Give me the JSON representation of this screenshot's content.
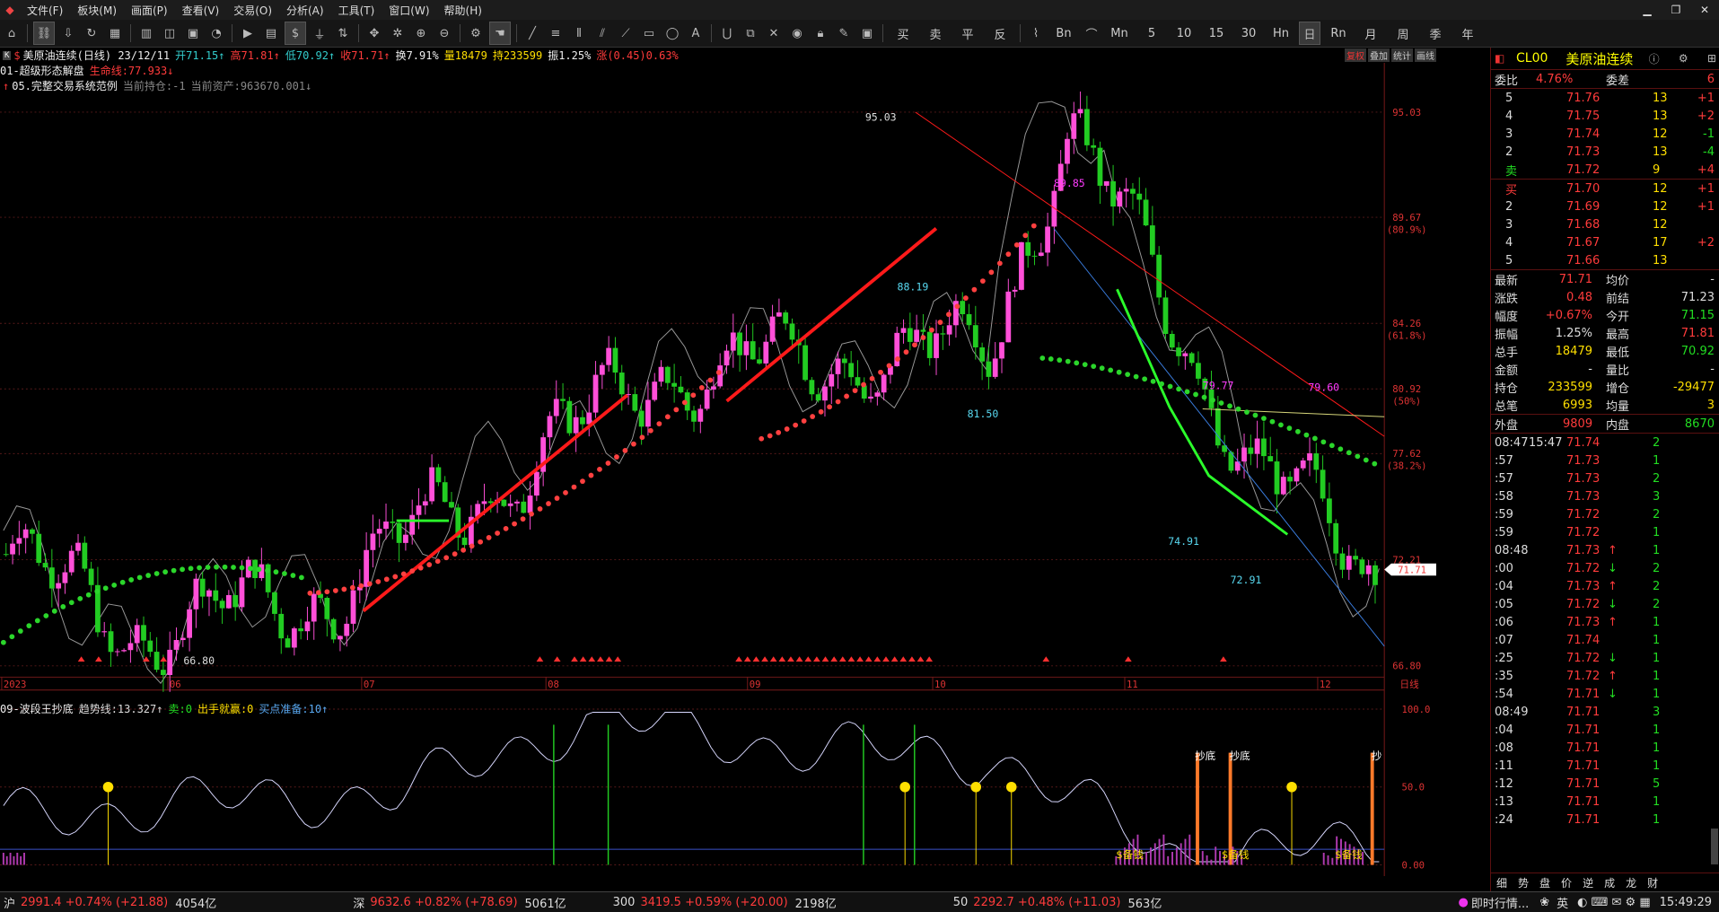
{
  "menu": {
    "items": [
      "文件(F)",
      "板块(M)",
      "画面(P)",
      "查看(V)",
      "交易(O)",
      "分析(A)",
      "工具(T)",
      "窗口(W)",
      "帮助(H)"
    ]
  },
  "toolbar": {
    "period_buttons": [
      "买",
      "卖",
      "平",
      "反"
    ],
    "interval_buttons": [
      "Bn",
      "Mn",
      "5",
      "10",
      "15",
      "30",
      "Hn",
      "Rn",
      "月",
      "季",
      "年"
    ],
    "dollar": "$"
  },
  "chart_header": {
    "title": "美原油连续(日线) 23/12/11",
    "open": "开71.15↑",
    "high": "高71.81↑",
    "low": "低70.92↑",
    "close": "收71.71↑",
    "turnover": "换7.91%",
    "volume": "量18479",
    "oi": "持233599",
    "amplitude": "振1.25%",
    "change": "涨(0.45)0.63%",
    "line2_name": "01-超级形态解盘",
    "line2_value": "生命线:77.933↓",
    "line3_name": "05.完整交易系统范例",
    "line3_pos": "当前持仓:-1",
    "line3_assets": "当前资产:963670.001↓",
    "right_buttons": [
      "复权",
      "叠加",
      "统计",
      "画线"
    ]
  },
  "price_axis": {
    "ticks": [
      "95.03",
      "89.67",
      "(80.9%)",
      "84.26",
      "(61.8%)",
      "80.92",
      "(50%)",
      "77.62",
      "(38.2%)",
      "72.21",
      "66.80"
    ],
    "current_price": "71.71"
  },
  "date_axis": {
    "labels": [
      "2023",
      "06",
      "07",
      "08",
      "09",
      "10",
      "11",
      "12"
    ],
    "end_label": "日线"
  },
  "annotations": {
    "high": "95.03",
    "p8985": "89.85",
    "p8819": "88.19",
    "p8150": "81.50",
    "p7977": "79.77",
    "p7960": "79.60",
    "p7491": "74.91",
    "p7291": "72.91",
    "low": "66.80"
  },
  "chart_data": [
    {
      "type": "line",
      "title": "美原油连续(日线)",
      "ylim": [
        66.8,
        95.03
      ],
      "x": [
        "2023",
        "06",
        "07",
        "08",
        "09",
        "10",
        "11",
        "12"
      ],
      "series": [
        {
          "name": "收",
          "values": [
            72.5,
            69.5,
            70.6,
            81.8,
            83.0,
            90.8,
            77.2,
            71.71
          ]
        }
      ]
    },
    {
      "type": "line",
      "title": "09-波段王抄底",
      "ylim": [
        0,
        100
      ],
      "x": [
        "2023",
        "06",
        "07",
        "08",
        "09",
        "10",
        "11",
        "12"
      ],
      "series": [
        {
          "name": "趋势线",
          "values": [
            30,
            40,
            45,
            95,
            75,
            70,
            5,
            13.327
          ]
        }
      ]
    }
  ],
  "sub_indicator": {
    "name": "09-波段王抄底",
    "trend": "趋势线:13.327↑",
    "sell": "卖:0",
    "shoot": "出手就赢:0",
    "buyprep": "买点准备:10↑",
    "axis": [
      "100.0",
      "50.0",
      "0.00"
    ],
    "labels": [
      "抄底",
      "抄底",
      "抄"
    ],
    "money": [
      "$备钱",
      "$备钱",
      "$备钱"
    ]
  },
  "quote_panel": {
    "code": "CL00",
    "name": "美原油连续",
    "webi_label": "委比",
    "webi": "4.76%",
    "wecha_label": "委差",
    "wecha": "6",
    "asks": [
      {
        "lvl": "5",
        "price": "71.76",
        "vol": "13",
        "chg": "+1"
      },
      {
        "lvl": "4",
        "price": "71.75",
        "vol": "13",
        "chg": "+2"
      },
      {
        "lvl": "3",
        "price": "71.74",
        "vol": "12",
        "chg": "-1"
      },
      {
        "lvl": "2",
        "price": "71.73",
        "vol": "13",
        "chg": "-4"
      },
      {
        "lvl": "卖",
        "price": "71.72",
        "vol": "9",
        "chg": "+4"
      }
    ],
    "bids": [
      {
        "lvl": "买",
        "price": "71.70",
        "vol": "12",
        "chg": "+1"
      },
      {
        "lvl": "2",
        "price": "71.69",
        "vol": "12",
        "chg": "+1"
      },
      {
        "lvl": "3",
        "price": "71.68",
        "vol": "12",
        "chg": ""
      },
      {
        "lvl": "4",
        "price": "71.67",
        "vol": "17",
        "chg": "+2"
      },
      {
        "lvl": "5",
        "price": "71.66",
        "vol": "13",
        "chg": ""
      }
    ],
    "stats": [
      {
        "l1": "最新",
        "v1": "71.71",
        "l2": "均价",
        "v2": "-"
      },
      {
        "l1": "涨跌",
        "v1": "0.48",
        "l2": "前结",
        "v2": "71.23"
      },
      {
        "l1": "幅度",
        "v1": "+0.67%",
        "l2": "今开",
        "v2": "71.15"
      },
      {
        "l1": "振幅",
        "v1": "1.25%",
        "l2": "最高",
        "v2": "71.81"
      },
      {
        "l1": "总手",
        "v1": "18479",
        "l2": "最低",
        "v2": "70.92"
      },
      {
        "l1": "金额",
        "v1": "-",
        "l2": "量比",
        "v2": "-"
      },
      {
        "l1": "持仓",
        "v1": "233599",
        "l2": "增仓",
        "v2": "-29477"
      },
      {
        "l1": "总笔",
        "v1": "6993",
        "l2": "均量",
        "v2": "3"
      }
    ],
    "outer_label": "外盘",
    "outer": "9809",
    "inner_label": "内盘",
    "inner": "8670",
    "ticks": [
      {
        "t": "08:47",
        "t2": "15:47",
        "p": "71.74",
        "a": "",
        "v": "2"
      },
      {
        "t": ":57",
        "p": "71.73",
        "a": "",
        "v": "1"
      },
      {
        "t": ":57",
        "p": "71.73",
        "a": "",
        "v": "2"
      },
      {
        "t": ":58",
        "p": "71.73",
        "a": "",
        "v": "3"
      },
      {
        "t": ":59",
        "p": "71.72",
        "a": "",
        "v": "2"
      },
      {
        "t": ":59",
        "p": "71.72",
        "a": "",
        "v": "1"
      },
      {
        "t": "08:48",
        "p": "71.73",
        "a": "↑",
        "v": "1"
      },
      {
        "t": ":00",
        "p": "71.72",
        "a": "↓",
        "v": "2"
      },
      {
        "t": ":04",
        "p": "71.73",
        "a": "↑",
        "v": "2"
      },
      {
        "t": ":05",
        "p": "71.72",
        "a": "↓",
        "v": "2"
      },
      {
        "t": ":06",
        "p": "71.73",
        "a": "↑",
        "v": "1"
      },
      {
        "t": ":07",
        "p": "71.74",
        "a": "",
        "v": "1"
      },
      {
        "t": ":25",
        "p": "71.72",
        "a": "↓",
        "v": "1"
      },
      {
        "t": ":35",
        "p": "71.72",
        "a": "↑",
        "v": "1"
      },
      {
        "t": ":54",
        "p": "71.71",
        "a": "↓",
        "v": "1"
      },
      {
        "t": "08:49",
        "p": "71.71",
        "a": "",
        "v": "3"
      },
      {
        "t": ":04",
        "p": "71.71",
        "a": "",
        "v": "1"
      },
      {
        "t": ":08",
        "p": "71.71",
        "a": "",
        "v": "1"
      },
      {
        "t": ":11",
        "p": "71.71",
        "a": "",
        "v": "1"
      },
      {
        "t": ":12",
        "p": "71.71",
        "a": "",
        "v": "5"
      },
      {
        "t": ":13",
        "p": "71.71",
        "a": "",
        "v": "1"
      },
      {
        "t": ":24",
        "p": "71.71",
        "a": "",
        "v": "1"
      }
    ],
    "tabs": [
      "细",
      "势",
      "盘",
      "价",
      "逆",
      "成",
      "龙",
      "财"
    ]
  },
  "statusbar": {
    "sh_label": "沪",
    "sh": "2991.4 +0.74% (+21.88)",
    "sh_amt": "4054亿",
    "sz_label": "深",
    "sz": "9632.6 +0.82% (+78.69)",
    "sz_amt": "5061亿",
    "i300_label": "300",
    "i300": "3419.5 +0.59% (+20.00)",
    "i300_amt": "2198亿",
    "i50_label": "50",
    "i50": "2292.7 +0.48% (+11.03)",
    "i50_amt": "563亿",
    "news": "即时行情...",
    "ime": "英",
    "clock": "15:49:29"
  }
}
